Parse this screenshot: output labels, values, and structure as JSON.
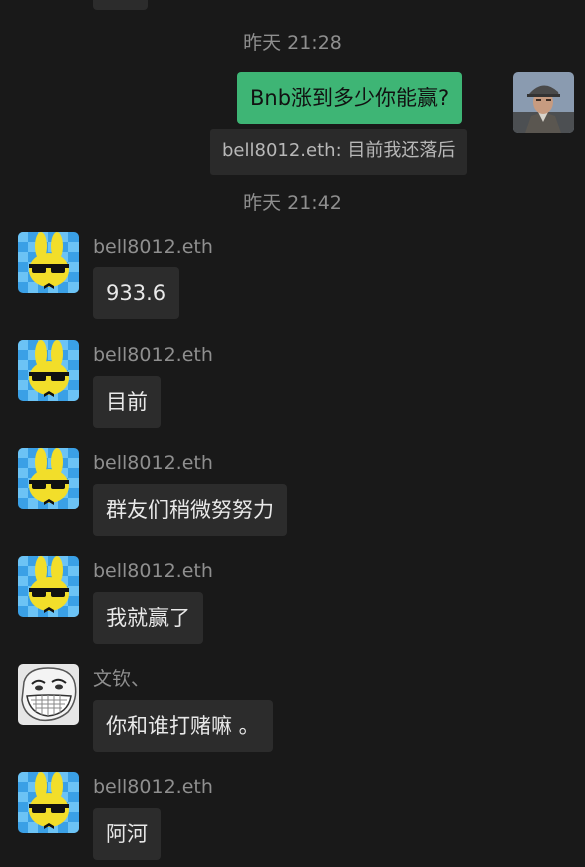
{
  "chat": {
    "timestamps": [
      "昨天 21:28",
      "昨天 21:42"
    ],
    "my_message": "Bnb涨到多少你能赢?",
    "notice": "bell8012.eth: 目前我还落后",
    "messages": [
      {
        "sender": "bell8012.eth",
        "text": "933.6",
        "avatar": "bunny-sunglasses-avatar"
      },
      {
        "sender": "bell8012.eth",
        "text": "目前",
        "avatar": "bunny-sunglasses-avatar"
      },
      {
        "sender": "bell8012.eth",
        "text": "群友们稍微努努力",
        "avatar": "bunny-sunglasses-avatar"
      },
      {
        "sender": "bell8012.eth",
        "text": "我就赢了",
        "avatar": "bunny-sunglasses-avatar"
      },
      {
        "sender": "文钦、",
        "text": "你和谁打赌嘛 。",
        "avatar": "trollface-avatar"
      },
      {
        "sender": "bell8012.eth",
        "text": "阿河",
        "avatar": "bunny-sunglasses-avatar"
      }
    ]
  },
  "colors": {
    "background": "#191919",
    "my_bubble": "#3eb575",
    "other_bubble": "#2c2c2c",
    "timestamp_text": "#8f8f8f"
  }
}
